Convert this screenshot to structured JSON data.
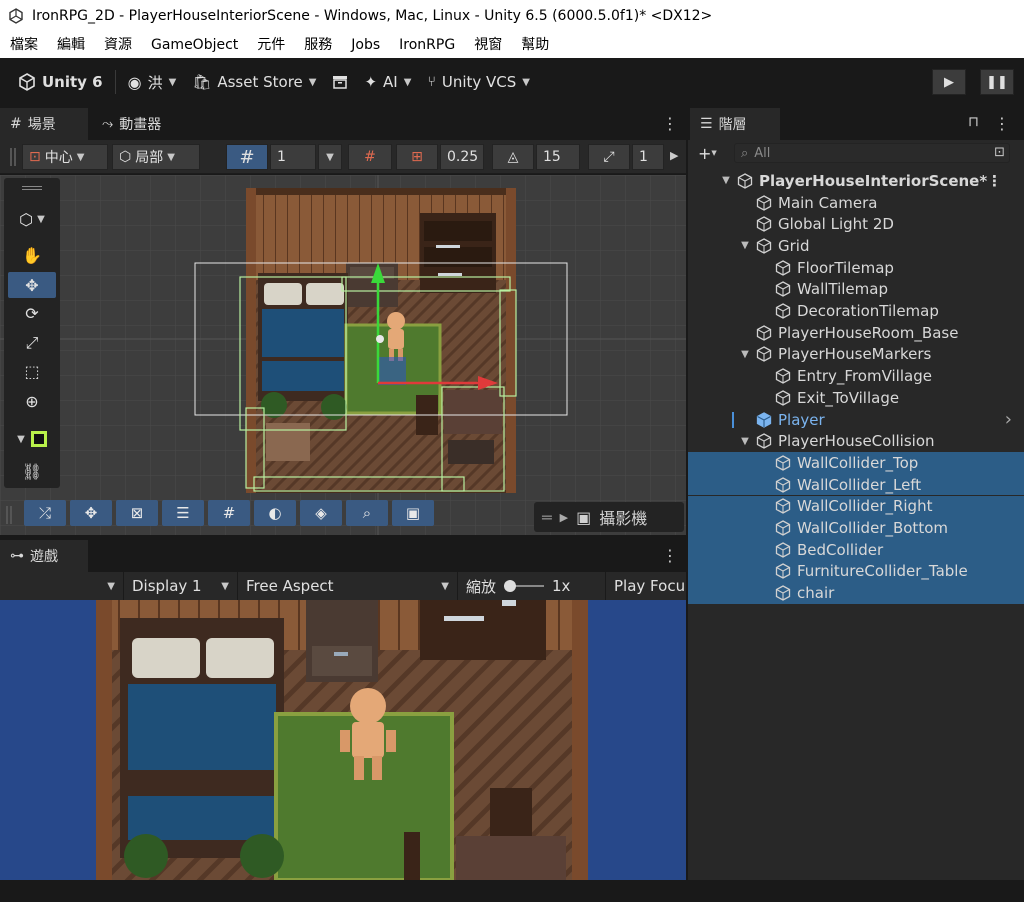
{
  "window": {
    "title": "IronRPG_2D - PlayerHouseInteriorScene - Windows, Mac, Linux - Unity 6.5 (6000.5.0f1)* <DX12>"
  },
  "menu": [
    "檔案",
    "編輯",
    "資源",
    "GameObject",
    "元件",
    "服務",
    "Jobs",
    "IronRPG",
    "視窗",
    "幫助"
  ],
  "toolbar": {
    "unity_label": "Unity 6",
    "account_label": "洪",
    "asset_store_label": "Asset Store",
    "ai_label": "AI",
    "vcs_label": "Unity VCS"
  },
  "scene_panel": {
    "tab_scene": "場景",
    "tab_animator": "動畫器",
    "pivot_label": "中心",
    "space_label": "局部",
    "grid_value": "1",
    "snap_value": "0.25",
    "rotate_snap_value": "15",
    "scale_snap_value": "1",
    "camera_label": "攝影機"
  },
  "game_panel": {
    "tab_game": "遊戲",
    "display_label": "Display 1",
    "aspect_label": "Free Aspect",
    "scale_label": "縮放",
    "scale_value": "1x",
    "play_focus_label": "Play Focu"
  },
  "hierarchy": {
    "tab_label": "階層",
    "search_placeholder": "All",
    "rows": [
      {
        "label": "PlayerHouseInteriorScene*",
        "depth": 0,
        "expand": true,
        "scene": true
      },
      {
        "label": "Main Camera",
        "depth": 1
      },
      {
        "label": "Global Light 2D",
        "depth": 1
      },
      {
        "label": "Grid",
        "depth": 1,
        "expand": true
      },
      {
        "label": "FloorTilemap",
        "depth": 2
      },
      {
        "label": "WallTilemap",
        "depth": 2
      },
      {
        "label": "DecorationTilemap",
        "depth": 2
      },
      {
        "label": "PlayerHouseRoom_Base",
        "depth": 1
      },
      {
        "label": "PlayerHouseMarkers",
        "depth": 1,
        "expand": true
      },
      {
        "label": "Entry_FromVillage",
        "depth": 2
      },
      {
        "label": "Exit_ToVillage",
        "depth": 2
      },
      {
        "label": "Player",
        "depth": 1,
        "prefab": true,
        "has_children": true
      },
      {
        "label": "PlayerHouseCollision",
        "depth": 1,
        "expand": true
      },
      {
        "label": "WallCollider_Top",
        "depth": 2,
        "selected": true
      },
      {
        "label": "WallCollider_Left",
        "depth": 2,
        "selected": true
      },
      {
        "label": "WallCollider_Right",
        "depth": 2,
        "selected": true
      },
      {
        "label": "WallCollider_Bottom",
        "depth": 2,
        "selected": true
      },
      {
        "label": "BedCollider",
        "depth": 2,
        "selected": true
      },
      {
        "label": "FurnitureCollider_Table",
        "depth": 2,
        "selected": true
      },
      {
        "label": "chair",
        "depth": 2,
        "selected": true
      }
    ]
  },
  "colors": {
    "accent": "#3a5a82",
    "selection": "#2c5d87",
    "prefab": "#7bb4ef",
    "game_bg": "#27488a"
  }
}
